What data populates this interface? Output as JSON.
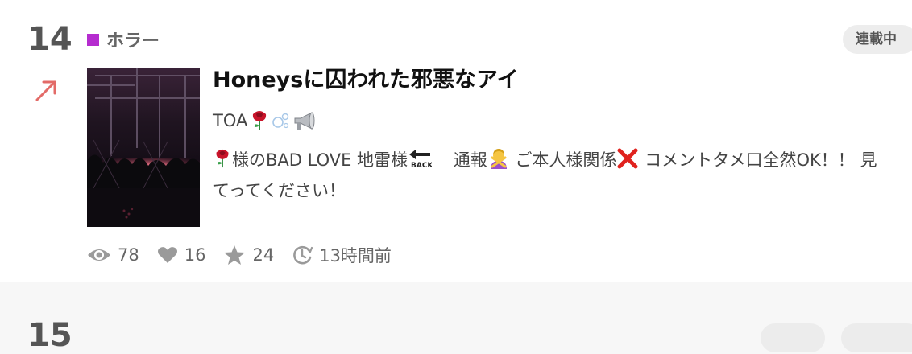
{
  "item": {
    "rank": "14",
    "genre": "ホラー",
    "genre_color": "#b52ccf",
    "status": "連載中",
    "trend_icon": "arrow-up-right-icon",
    "title": "Honeysに囚われた邪悪なアイ",
    "author": "TOA",
    "author_icons": [
      "rose-icon",
      "bubbles-icon",
      "loudspeaker-icon"
    ],
    "description": {
      "part1": "様のBAD LOVE 地雷様",
      "part2": "通報",
      "part3": "ご本人様関係",
      "part4": "コメントタメ口全然OK！！ 見てってください！"
    },
    "stats": {
      "views": "78",
      "likes": "16",
      "stars": "24",
      "updated": "13時間前"
    }
  },
  "next_item": {
    "rank": "15"
  }
}
